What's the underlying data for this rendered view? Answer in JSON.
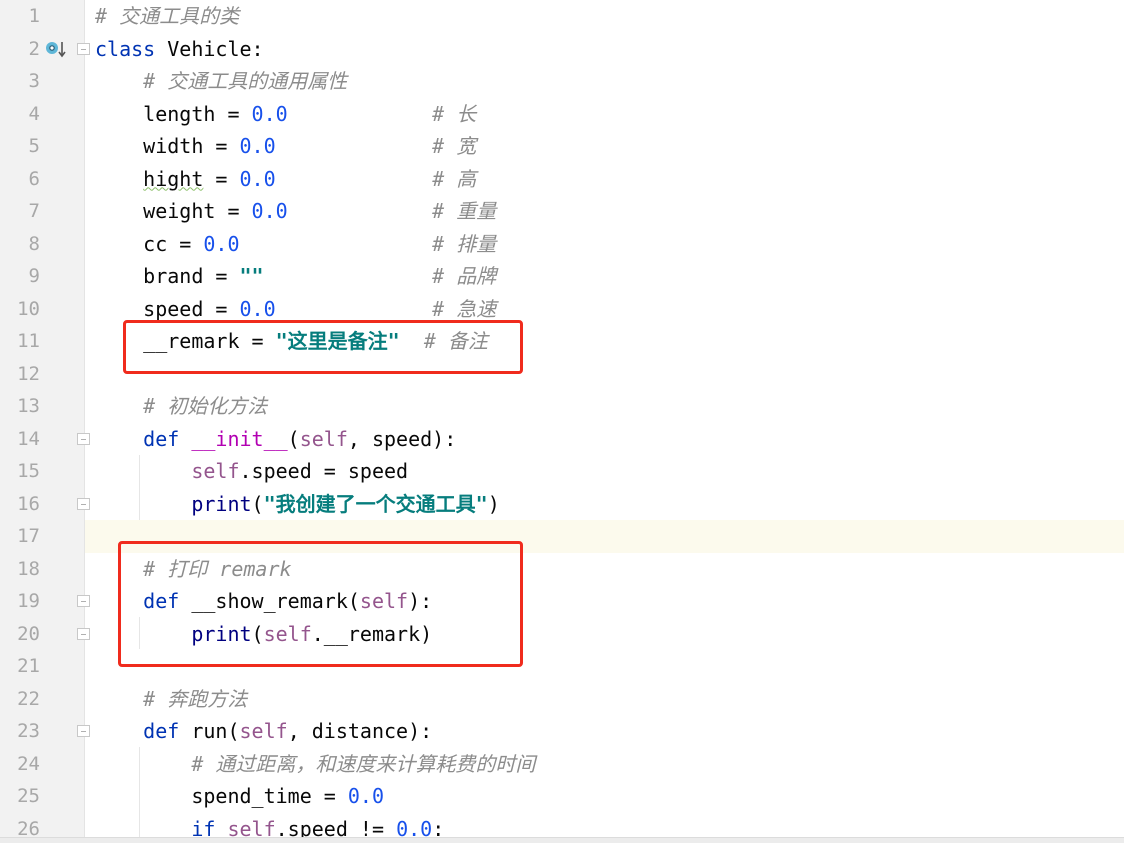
{
  "editor": {
    "language": "python",
    "current_line": 17,
    "highlight_color": "#f02b1d",
    "lines": [
      {
        "n": "1",
        "tokens": [
          [
            "cmt",
            "# 交通工具的类"
          ]
        ]
      },
      {
        "n": "2",
        "tokens": [
          [
            "kw",
            "class"
          ],
          [
            "p",
            " Vehicle:"
          ]
        ]
      },
      {
        "n": "3",
        "tokens": [
          [
            "p",
            "    "
          ],
          [
            "cmt",
            "# 交通工具的通用属性"
          ]
        ]
      },
      {
        "n": "4",
        "tokens": [
          [
            "p",
            "    length = "
          ],
          [
            "num",
            "0.0"
          ],
          [
            "p",
            "            "
          ],
          [
            "cmt",
            "# 长"
          ]
        ]
      },
      {
        "n": "5",
        "tokens": [
          [
            "p",
            "    width = "
          ],
          [
            "num",
            "0.0"
          ],
          [
            "p",
            "             "
          ],
          [
            "cmt",
            "# 宽"
          ]
        ]
      },
      {
        "n": "6",
        "tokens": [
          [
            "p",
            "    "
          ],
          [
            "warn",
            "hight"
          ],
          [
            "p",
            " = "
          ],
          [
            "num",
            "0.0"
          ],
          [
            "p",
            "             "
          ],
          [
            "cmt",
            "# 高"
          ]
        ]
      },
      {
        "n": "7",
        "tokens": [
          [
            "p",
            "    weight = "
          ],
          [
            "num",
            "0.0"
          ],
          [
            "p",
            "            "
          ],
          [
            "cmt",
            "# 重量"
          ]
        ]
      },
      {
        "n": "8",
        "tokens": [
          [
            "p",
            "    cc = "
          ],
          [
            "num",
            "0.0"
          ],
          [
            "p",
            "                "
          ],
          [
            "cmt",
            "# 排量"
          ]
        ]
      },
      {
        "n": "9",
        "tokens": [
          [
            "p",
            "    brand = "
          ],
          [
            "str",
            "\"\""
          ],
          [
            "p",
            "              "
          ],
          [
            "cmt",
            "# 品牌"
          ]
        ]
      },
      {
        "n": "10",
        "tokens": [
          [
            "p",
            "    speed = "
          ],
          [
            "num",
            "0.0"
          ],
          [
            "p",
            "             "
          ],
          [
            "cmt",
            "# 急速"
          ]
        ]
      },
      {
        "n": "11",
        "tokens": [
          [
            "p",
            "    __remark = "
          ],
          [
            "str",
            "\"这里是备注\""
          ],
          [
            "p",
            "  "
          ],
          [
            "cmt",
            "# 备注"
          ]
        ]
      },
      {
        "n": "12",
        "tokens": []
      },
      {
        "n": "13",
        "tokens": [
          [
            "p",
            "    "
          ],
          [
            "cmt",
            "# 初始化方法"
          ]
        ]
      },
      {
        "n": "14",
        "tokens": [
          [
            "p",
            "    "
          ],
          [
            "kw",
            "def"
          ],
          [
            "p",
            " "
          ],
          [
            "magic",
            "__init__"
          ],
          [
            "p",
            "("
          ],
          [
            "self",
            "self"
          ],
          [
            "p",
            ", speed):"
          ]
        ]
      },
      {
        "n": "15",
        "tokens": [
          [
            "p",
            "        "
          ],
          [
            "self",
            "self"
          ],
          [
            "p",
            ".speed = speed"
          ]
        ]
      },
      {
        "n": "16",
        "tokens": [
          [
            "p",
            "        "
          ],
          [
            "builtin",
            "print"
          ],
          [
            "p",
            "("
          ],
          [
            "str",
            "\"我创建了一个交通工具\""
          ],
          [
            "p",
            ")"
          ]
        ]
      },
      {
        "n": "17",
        "tokens": []
      },
      {
        "n": "18",
        "tokens": [
          [
            "p",
            "    "
          ],
          [
            "cmt",
            "# 打印 remark"
          ]
        ]
      },
      {
        "n": "19",
        "tokens": [
          [
            "p",
            "    "
          ],
          [
            "kw",
            "def"
          ],
          [
            "p",
            " __show_remark("
          ],
          [
            "self",
            "self"
          ],
          [
            "p",
            "):"
          ]
        ]
      },
      {
        "n": "20",
        "tokens": [
          [
            "p",
            "        "
          ],
          [
            "builtin",
            "print"
          ],
          [
            "p",
            "("
          ],
          [
            "self",
            "self"
          ],
          [
            "p",
            ".__remark)"
          ]
        ]
      },
      {
        "n": "21",
        "tokens": []
      },
      {
        "n": "22",
        "tokens": [
          [
            "p",
            "    "
          ],
          [
            "cmt",
            "# 奔跑方法"
          ]
        ]
      },
      {
        "n": "23",
        "tokens": [
          [
            "p",
            "    "
          ],
          [
            "kw",
            "def"
          ],
          [
            "p",
            " run("
          ],
          [
            "self",
            "self"
          ],
          [
            "p",
            ", distance):"
          ]
        ]
      },
      {
        "n": "24",
        "tokens": [
          [
            "p",
            "        "
          ],
          [
            "cmt",
            "# 通过距离，和速度来计算耗费的时间"
          ]
        ]
      },
      {
        "n": "25",
        "tokens": [
          [
            "p",
            "        spend_time = "
          ],
          [
            "num",
            "0.0"
          ]
        ]
      },
      {
        "n": "26",
        "tokens": [
          [
            "p",
            "        "
          ],
          [
            "kw",
            "if"
          ],
          [
            "p",
            " "
          ],
          [
            "self",
            "self"
          ],
          [
            "p",
            ".speed != "
          ],
          [
            "num",
            "0.0"
          ],
          [
            "p",
            ":"
          ]
        ]
      }
    ]
  }
}
